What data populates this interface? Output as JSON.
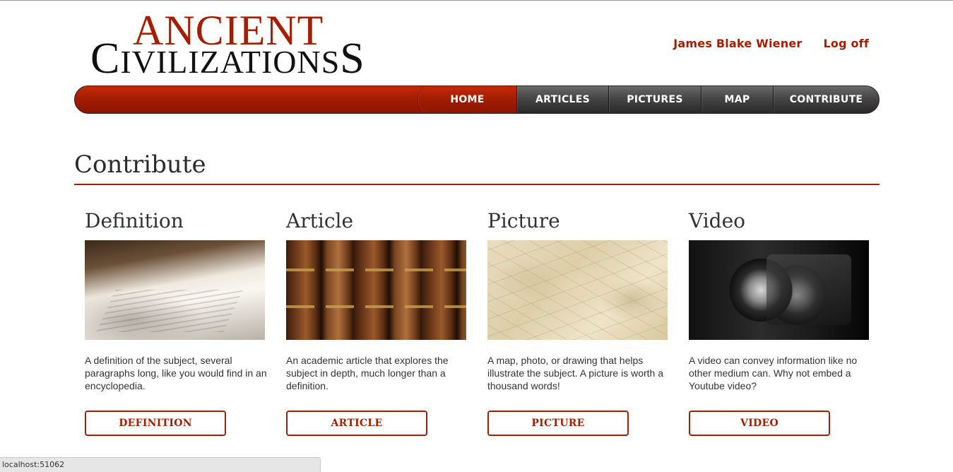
{
  "logo": {
    "line1": "ANCIENT",
    "line2_first": "C",
    "line2_mid": "IVILIZATIONS"
  },
  "user": {
    "name": "James Blake Wiener",
    "logoff_label": "Log off"
  },
  "nav": {
    "items": [
      {
        "label": "HOME",
        "active": true
      },
      {
        "label": "ARTICLES"
      },
      {
        "label": "PICTURES"
      },
      {
        "label": "MAP"
      },
      {
        "label": "CONTRIBUTE"
      }
    ]
  },
  "page": {
    "title": "Contribute"
  },
  "cards": [
    {
      "heading": "Definition",
      "description": "A definition of the subject, several paragraphs long, like you would find in an encyclopedia.",
      "button_label": "DEFINITION"
    },
    {
      "heading": "Article",
      "description": "An academic article that explores the subject in depth, much longer than a definition.",
      "button_label": "ARTICLE"
    },
    {
      "heading": "Picture",
      "description": "A map, photo, or drawing that helps illustrate the subject. A picture is worth a thousand words!",
      "button_label": "PICTURE"
    },
    {
      "heading": "Video",
      "description": "A video can convey information like no other medium can. Why not embed a Youtube video?",
      "button_label": "VIDEO"
    }
  ],
  "status_bar": {
    "text": "localhost:51062"
  },
  "colors": {
    "accent": "#a61d00",
    "nav_dark": "#3a3a3a"
  }
}
